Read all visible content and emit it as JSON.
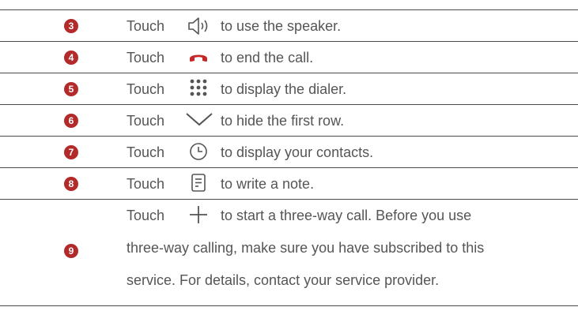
{
  "rows": [
    {
      "num": "3",
      "touch": "Touch",
      "text": "to use the speaker.",
      "icon": "speaker-icon"
    },
    {
      "num": "4",
      "touch": "Touch",
      "text": "to end the call.",
      "icon": "end-call-icon"
    },
    {
      "num": "5",
      "touch": "Touch",
      "text": "to display the dialer.",
      "icon": "dialpad-icon"
    },
    {
      "num": "6",
      "touch": "Touch",
      "text": "to hide the first row.",
      "icon": "chevron-down-icon"
    },
    {
      "num": "7",
      "touch": "Touch",
      "text": "to display your contacts.",
      "icon": "clock-icon"
    },
    {
      "num": "8",
      "touch": "Touch",
      "text": "to write a note.",
      "icon": "note-icon"
    },
    {
      "num": "9",
      "touch": "Touch",
      "text": "to start a three-way call. Before you use",
      "line2": "three-way calling, make sure you have subscribed to this",
      "line3": "service. For details, contact your service provider.",
      "icon": "plus-icon"
    }
  ],
  "colors": {
    "badge": "#b22a2a",
    "icon": "#555555",
    "end_call": "#c62828",
    "rule": "#4a4a4a"
  }
}
